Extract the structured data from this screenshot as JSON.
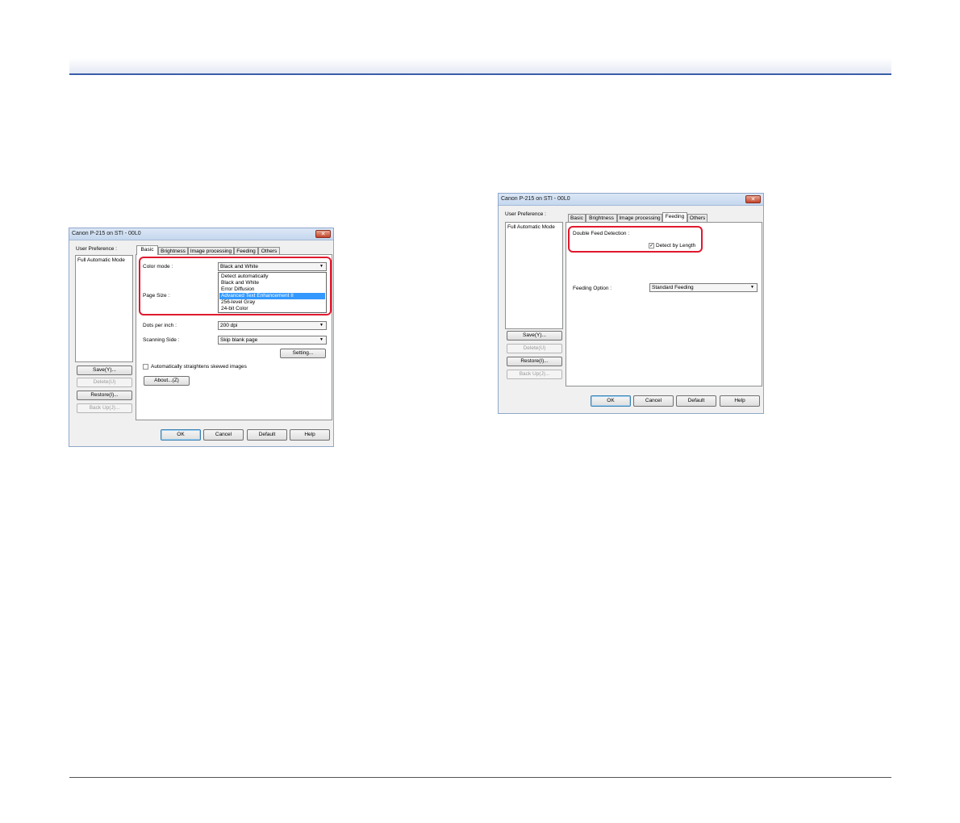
{
  "dialog1": {
    "title": "Canon P-215 on STI - 00L0",
    "close_glyph": "✕",
    "user_preference_label": "User Preference :",
    "preference_items": [
      "Full Automatic Mode"
    ],
    "buttons": {
      "save": "Save(Y)...",
      "delete": "Delete(U)",
      "restore": "Restore(I)...",
      "backup": "Back Up(J)..."
    },
    "tabs": [
      "Basic",
      "Brightness",
      "Image processing",
      "Feeding",
      "Others"
    ],
    "active_tab": "Basic",
    "color_mode_label": "Color mode :",
    "color_mode_value": "Black and White",
    "color_mode_options": [
      "Detect automatically",
      "Black and White",
      "Error Diffusion",
      "Advanced Text Enhancement II",
      "256-level Gray",
      "24-bit Color"
    ],
    "color_mode_highlighted": "Advanced Text Enhancement II",
    "page_size_label": "Page Size :",
    "dpi_label": "Dots per inch :",
    "dpi_value": "200 dpi",
    "scanning_side_label": "Scanning Side :",
    "scanning_side_value": "Skip blank page",
    "setting_button": "Setting...",
    "straighten_label": "Automatically straightens skewed images",
    "straighten_checked": false,
    "about_button": "About...(Z)",
    "footer_buttons": {
      "ok": "OK",
      "cancel": "Cancel",
      "default": "Default",
      "help": "Help"
    }
  },
  "dialog2": {
    "title": "Canon P-215 on STI - 00L0",
    "close_glyph": "✕",
    "user_preference_label": "User Preference :",
    "preference_items": [
      "Full Automatic Mode"
    ],
    "buttons": {
      "save": "Save(Y)...",
      "delete": "Delete(U)",
      "restore": "Restore(I)...",
      "backup": "Back Up(J)..."
    },
    "tabs": [
      "Basic",
      "Brightness",
      "Image processing",
      "Feeding",
      "Others"
    ],
    "active_tab": "Feeding",
    "double_feed_label": "Double Feed Detection :",
    "detect_by_length_label": "Detect by Length",
    "detect_by_length_checked": true,
    "check_glyph": "✓",
    "feeding_option_label": "Feeding Option :",
    "feeding_option_value": "Standard Feeding",
    "footer_buttons": {
      "ok": "OK",
      "cancel": "Cancel",
      "default": "Default",
      "help": "Help"
    }
  },
  "colors": {
    "highlight_box": "#e0192e",
    "header_rule": "#3a5ea8",
    "selection": "#3399ff"
  },
  "icons": {
    "dropdown": "chevron-down-icon",
    "close": "close-icon",
    "check": "checkmark-icon"
  }
}
